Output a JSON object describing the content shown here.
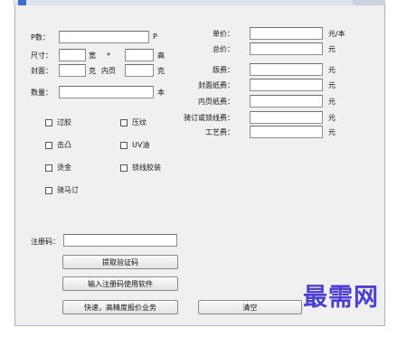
{
  "window": {
    "title": ""
  },
  "left": {
    "p_label": "P数：",
    "p_value": "",
    "p_unit": "P",
    "size_label": "尺寸：",
    "width_value": "",
    "width_unit": "宽",
    "times": "*",
    "height_value": "",
    "height_unit": "高",
    "cover_label": "封面：",
    "cover_value": "",
    "cover_unit": "克",
    "inner_label": "内页",
    "inner_value": "",
    "inner_unit": "克",
    "qty_label": "数量：",
    "qty_value": "",
    "qty_unit": "本"
  },
  "right": {
    "rows": [
      {
        "label": "单价：",
        "value": "",
        "unit": "元/本"
      },
      {
        "label": "总价：",
        "value": "",
        "unit": "元"
      },
      {
        "label": "版费：",
        "value": "",
        "unit": "元"
      },
      {
        "label": "封面纸费：",
        "value": "",
        "unit": "元"
      },
      {
        "label": "内页纸费：",
        "value": "",
        "unit": "元"
      },
      {
        "label": "骑订或锁线费：",
        "value": "",
        "unit": "元"
      },
      {
        "label": "工艺费：",
        "value": "",
        "unit": "元"
      }
    ]
  },
  "options": {
    "laminate": "过胶",
    "emboss_press": "压纹",
    "emboss": "击凸",
    "uv": "UV油",
    "hot_stamp": "烫金",
    "thread_bind": "锁线胶装",
    "saddle_stitch": "骑马订"
  },
  "registration": {
    "label": "注册码：",
    "value": "",
    "get_code_button": "提取验证码",
    "register_button": "输入注册码使用软件"
  },
  "bottom": {
    "quote_button": "快速，高精度报价业务",
    "clear_button": "清空"
  },
  "watermark": "最需网"
}
